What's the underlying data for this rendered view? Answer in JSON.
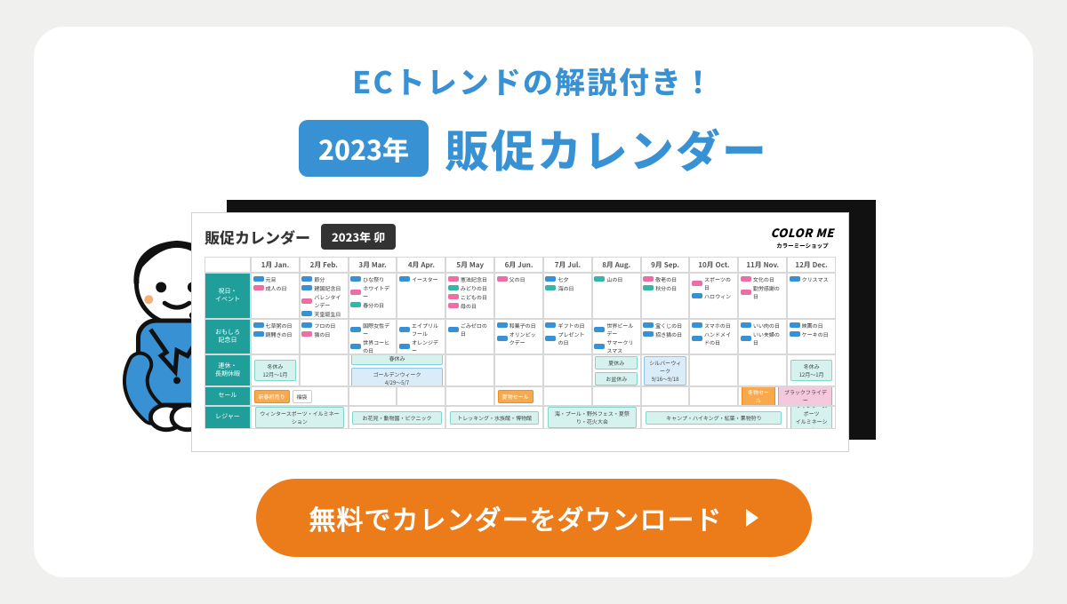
{
  "headline": "ECトレンドの解説付き！",
  "year_pill": "2023年",
  "main_title": "販促カレンダー",
  "sheet_title": "販促カレンダー",
  "sheet_year": "2023年 卯",
  "brand_main": "COLOR ME",
  "brand_sub": "カラーミーショップ",
  "months": [
    "1月 Jan.",
    "2月 Feb.",
    "3月 Mar.",
    "4月 Apr.",
    "5月 May",
    "6月 Jun.",
    "7月 Jul.",
    "8月 Aug.",
    "9月 Sep.",
    "10月 Oct.",
    "11月 Nov.",
    "12月 Dec."
  ],
  "row_labels": {
    "events": "祝日・\nイベント",
    "fun": "おもしろ\n記念日",
    "holiday": "連休・\n長期休暇",
    "sale": "セール",
    "leisure": "レジャー"
  },
  "events": {
    "jan": [
      [
        "blue",
        "元旦"
      ],
      [
        "pink",
        "成人の日"
      ]
    ],
    "feb": [
      [
        "blue",
        "節分"
      ],
      [
        "blue",
        "建国記念日"
      ],
      [
        "pink",
        "バレンタインデー"
      ],
      [
        "blue",
        "天皇誕生日"
      ]
    ],
    "mar": [
      [
        "blue",
        "ひな祭り"
      ],
      [
        "pink",
        "ホワイトデー"
      ],
      [
        "teal",
        "春分の日"
      ]
    ],
    "apr": [
      [
        "blue",
        "イースター"
      ]
    ],
    "may": [
      [
        "pink",
        "憲法記念日"
      ],
      [
        "teal",
        "みどりの日"
      ],
      [
        "pink",
        "こどもの日"
      ],
      [
        "pink",
        "母の日"
      ]
    ],
    "jun": [
      [
        "pink",
        "父の日"
      ]
    ],
    "jul": [
      [
        "blue",
        "七夕"
      ],
      [
        "teal",
        "海の日"
      ]
    ],
    "aug": [
      [
        "teal",
        "山の日"
      ]
    ],
    "sep": [
      [
        "pink",
        "敬老の日"
      ],
      [
        "teal",
        "秋分の日"
      ]
    ],
    "oct": [
      [
        "pink",
        "スポーツの日"
      ],
      [
        "blue",
        "ハロウィン"
      ]
    ],
    "nov": [
      [
        "pink",
        "文化の日"
      ],
      [
        "pink",
        "勤労感謝の日"
      ]
    ],
    "dec": [
      [
        "blue",
        "クリスマス"
      ]
    ]
  },
  "fun": {
    "jan": [
      [
        "blue",
        "七草粥の日"
      ],
      [
        "blue",
        "鏡開きの日"
      ]
    ],
    "feb": [
      [
        "blue",
        "フロの日"
      ],
      [
        "pink",
        "猫の日"
      ]
    ],
    "mar": [
      [
        "blue",
        "国際女性デー"
      ],
      [
        "blue",
        "世界コーヒの日"
      ]
    ],
    "apr": [
      [
        "blue",
        "エイプリルフール"
      ],
      [
        "blue",
        "オレンジデー"
      ]
    ],
    "may": [
      [
        "blue",
        "ごみゼロの日"
      ]
    ],
    "jun": [
      [
        "blue",
        "和菓子の日"
      ],
      [
        "blue",
        "オリンピックデー"
      ]
    ],
    "jul": [
      [
        "blue",
        "ギフトの日"
      ],
      [
        "blue",
        "プレゼントの日"
      ]
    ],
    "aug": [
      [
        "blue",
        "世界ビールデー"
      ],
      [
        "blue",
        "サマークリスマス"
      ]
    ],
    "sep": [
      [
        "blue",
        "宝くじの日"
      ],
      [
        "blue",
        "招き猫の日"
      ]
    ],
    "oct": [
      [
        "blue",
        "スマホの日"
      ],
      [
        "blue",
        "ハンドメイドの日"
      ]
    ],
    "nov": [
      [
        "blue",
        "いい肉の日"
      ],
      [
        "blue",
        "いい夫婦の日"
      ]
    ],
    "dec": [
      [
        "blue",
        "映画の日"
      ],
      [
        "blue",
        "ケーキの日"
      ]
    ]
  },
  "holidays": {
    "jan": "冬休み\n12月〜1月",
    "mar": "春休み",
    "apr": "ゴールデンウィーク\n4/29〜5/7",
    "aug": "夏休み",
    "aug2": "お盆休み",
    "sep": "シルバーウィーク\n9/16〜9/18",
    "dec": "冬休み\n12月〜1月"
  },
  "sales": {
    "jan": "新春初売り",
    "jan2": "福袋",
    "jun": "夏物セール",
    "nov": "冬物セール",
    "nov2": "ブラックフライデー"
  },
  "leisure": {
    "winter": "ウィンタースポーツ・イルミネーション",
    "spring": "お花見・動物園・ピクニック",
    "early_summer": "トレッキング・水族館・博物館",
    "summer": "海・プール・野外フェス・夏祭り・花火大会",
    "autumn": "キャンプ・ハイキング・紅葉・果物狩り",
    "winter2": "ウィンタースポーツ\nイルミネーション"
  },
  "cta_label": "無料でカレンダーをダウンロード"
}
